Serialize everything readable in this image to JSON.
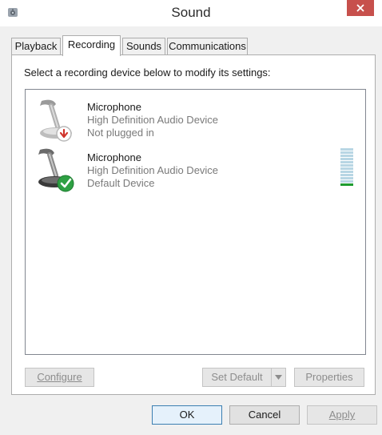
{
  "window": {
    "title": "Sound",
    "close_icon": "close-icon",
    "app_icon": "speaker-icon",
    "accent_close": "#c7504c"
  },
  "tabs": [
    {
      "label": "Playback",
      "active": false
    },
    {
      "label": "Recording",
      "active": true
    },
    {
      "label": "Sounds",
      "active": false
    },
    {
      "label": "Communications",
      "active": false
    }
  ],
  "recording": {
    "instruction": "Select a recording device below to modify its settings:",
    "devices": [
      {
        "name": "Microphone",
        "driver": "High Definition Audio Device",
        "status": "Not plugged in",
        "icon": "microphone-unplugged-icon",
        "badge": "red-down-arrow"
      },
      {
        "name": "Microphone",
        "driver": "High Definition Audio Device",
        "status": "Default Device",
        "icon": "microphone-default-icon",
        "badge": "green-check",
        "level_fraction": 0.1
      }
    ],
    "buttons": {
      "configure": "Configure",
      "set_default": "Set Default",
      "properties": "Properties"
    }
  },
  "dialog_buttons": {
    "ok": "OK",
    "cancel": "Cancel",
    "apply": "Apply"
  }
}
